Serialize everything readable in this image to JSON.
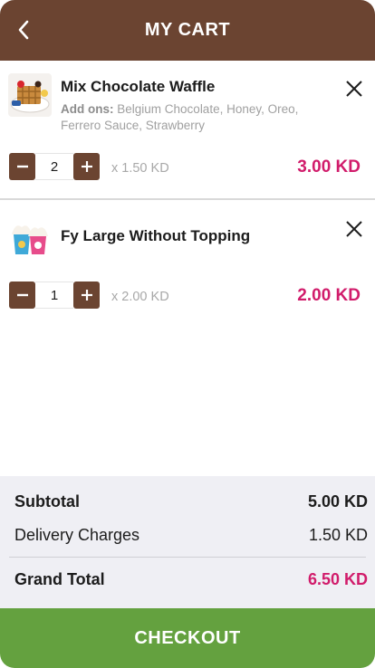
{
  "header": {
    "title": "MY CART",
    "back_icon": "chevron-left-icon",
    "bg_color": "#6b4431"
  },
  "items": [
    {
      "name": "Mix Chocolate Waffle",
      "addons_label": "Add ons:",
      "addons": "Belgium Chocolate, Honey, Oreo, Ferrero Sauce, Strawberry",
      "quantity": "2",
      "unit_price": "x 1.50 KD",
      "total": "3.00 KD"
    },
    {
      "name": "Fy Large Without Topping",
      "quantity": "1",
      "unit_price": "x 2.00 KD",
      "total": "2.00 KD"
    }
  ],
  "summary": {
    "subtotal_label": "Subtotal",
    "subtotal_value": "5.00 KD",
    "delivery_label": "Delivery Charges",
    "delivery_value": "1.50 KD",
    "grand_label": "Grand Total",
    "grand_value": "6.50 KD"
  },
  "checkout": {
    "label": "CHECKOUT",
    "color": "#64a13f"
  },
  "colors": {
    "accent_price": "#d11c6b",
    "brand_brown": "#6b4431"
  }
}
